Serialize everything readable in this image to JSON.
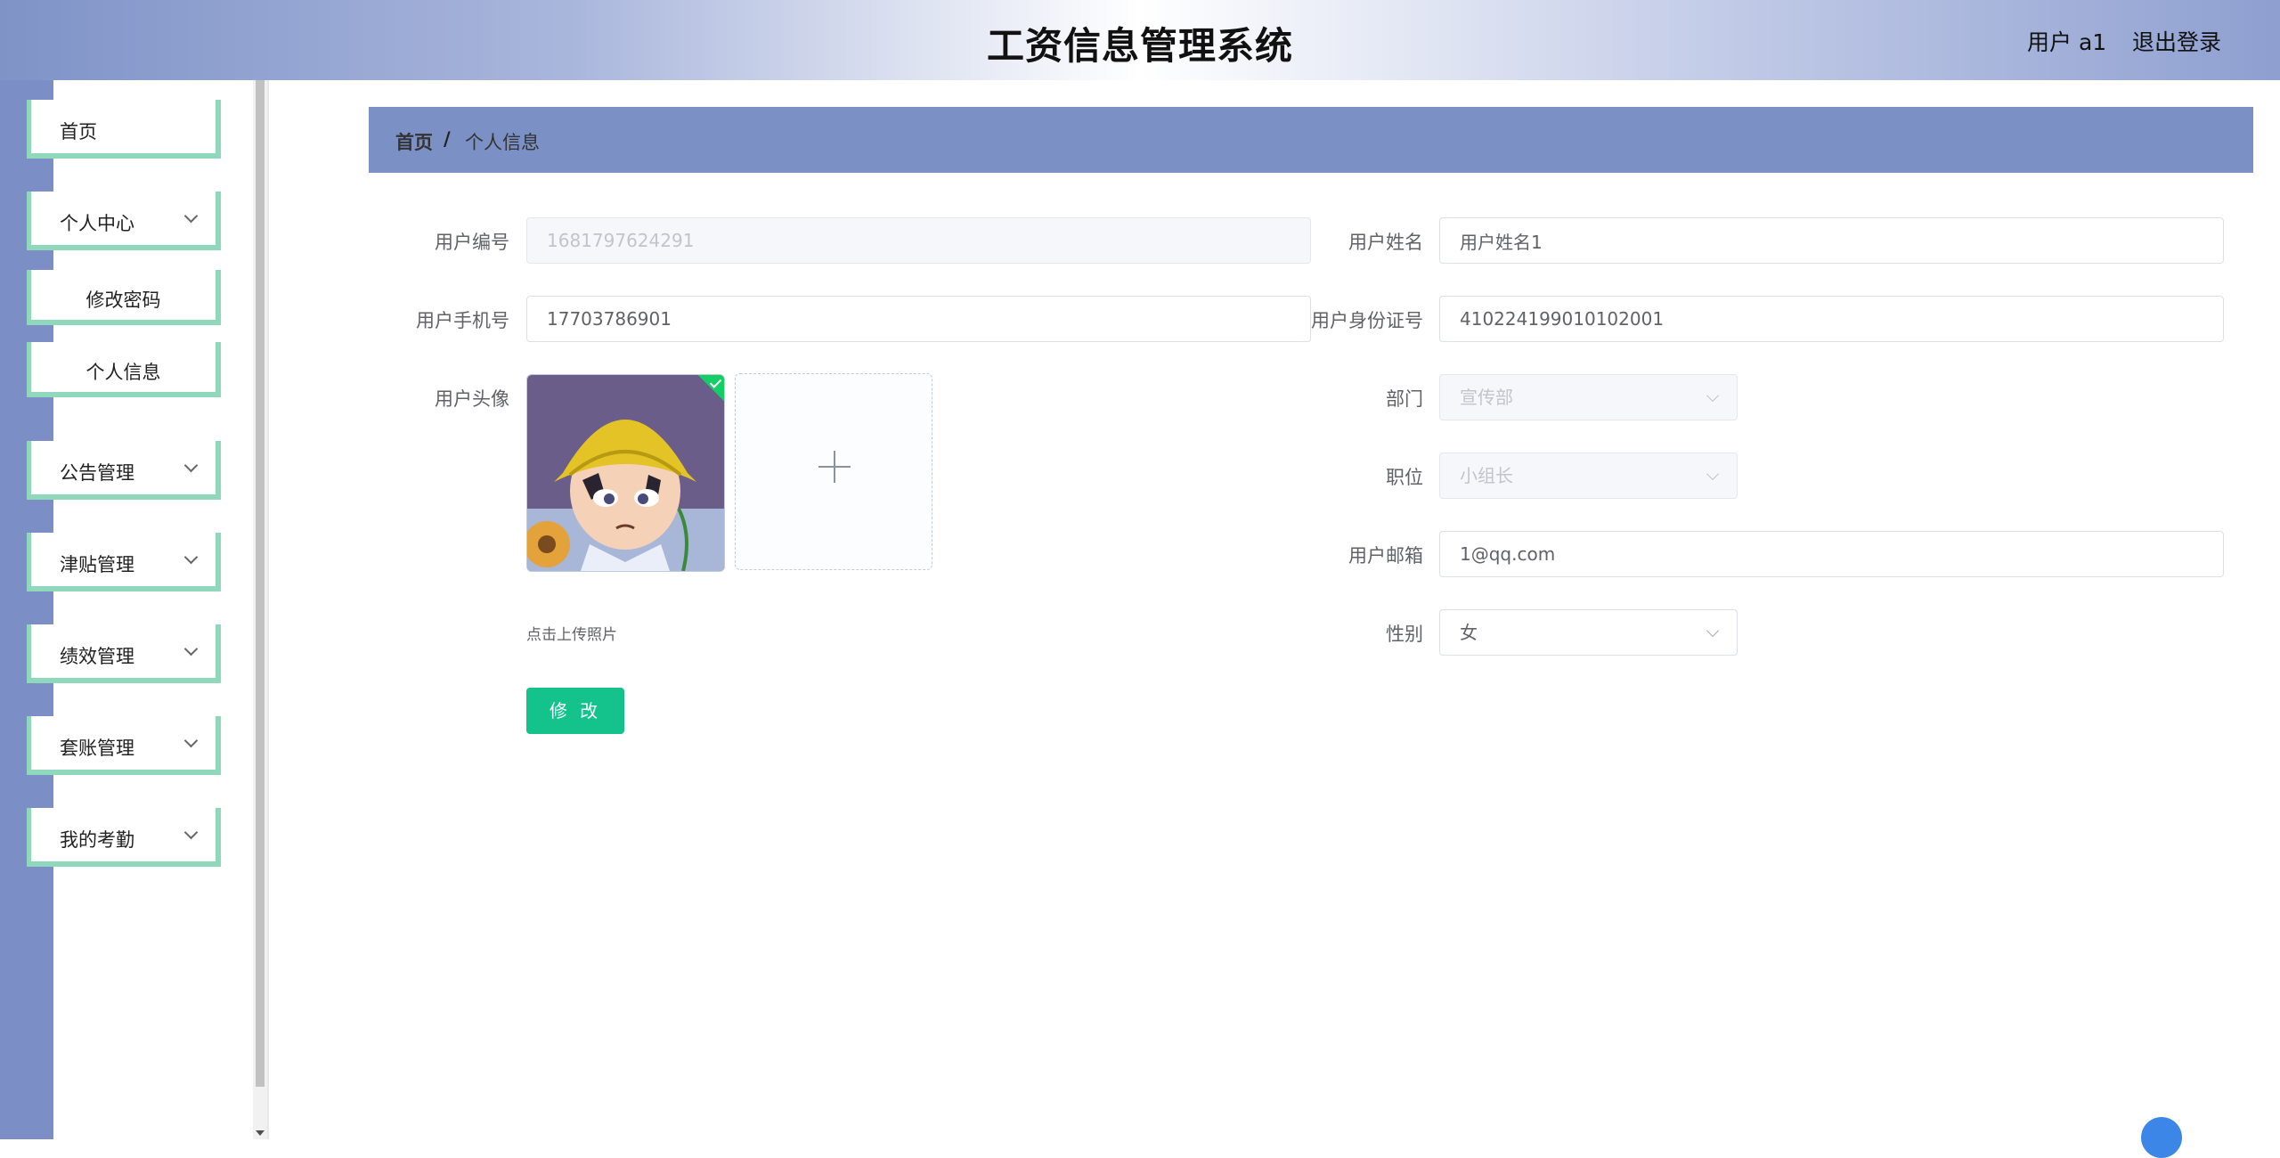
{
  "header": {
    "title": "工资信息管理系统",
    "user_label": "用户 a1",
    "logout_label": "退出登录"
  },
  "sidebar": {
    "items": [
      {
        "label": "首页"
      },
      {
        "label": "个人中心"
      },
      {
        "label": "公告管理"
      },
      {
        "label": "津贴管理"
      },
      {
        "label": "绩效管理"
      },
      {
        "label": "套账管理"
      },
      {
        "label": "我的考勤"
      }
    ],
    "subitems": [
      {
        "label": "修改密码"
      },
      {
        "label": "个人信息"
      }
    ]
  },
  "breadcrumb": {
    "home": "首页",
    "separator": "/",
    "current": "个人信息"
  },
  "form": {
    "user_id": {
      "label": "用户编号",
      "value": "1681797624291"
    },
    "user_name": {
      "label": "用户姓名",
      "value": "用户姓名1"
    },
    "phone": {
      "label": "用户手机号",
      "value": "17703786901"
    },
    "id_card": {
      "label": "用户身份证号",
      "value": "410224199010102001"
    },
    "avatar": {
      "label": "用户头像",
      "upload_tip": "点击上传照片"
    },
    "department": {
      "label": "部门",
      "value": "宣传部"
    },
    "position": {
      "label": "职位",
      "value": "小组长"
    },
    "email": {
      "label": "用户邮箱",
      "value": "1@qq.com"
    },
    "gender": {
      "label": "性别",
      "value": "女"
    },
    "submit_label": "修 改"
  },
  "colors": {
    "accent": "#13c38b",
    "menu_border": "#8fd8bb",
    "breadcrumb_bg": "#7b90c5",
    "sidebar_bg": "#7b8fc6"
  }
}
